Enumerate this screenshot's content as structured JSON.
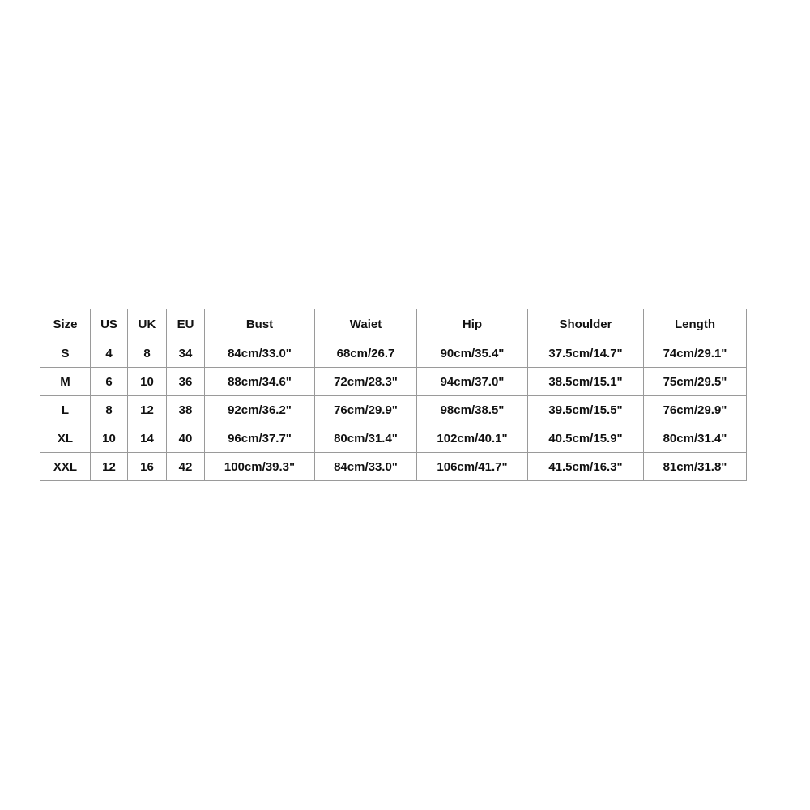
{
  "size_chart": {
    "headers": [
      "Size",
      "US",
      "UK",
      "EU",
      "Bust",
      "Waiet",
      "Hip",
      "Shoulder",
      "Length"
    ],
    "rows": [
      [
        "S",
        "4",
        "8",
        "34",
        "84cm/33.0\"",
        "68cm/26.7",
        "90cm/35.4\"",
        "37.5cm/14.7\"",
        "74cm/29.1\""
      ],
      [
        "M",
        "6",
        "10",
        "36",
        "88cm/34.6\"",
        "72cm/28.3\"",
        "94cm/37.0\"",
        "38.5cm/15.1\"",
        "75cm/29.5\""
      ],
      [
        "L",
        "8",
        "12",
        "38",
        "92cm/36.2\"",
        "76cm/29.9\"",
        "98cm/38.5\"",
        "39.5cm/15.5\"",
        "76cm/29.9\""
      ],
      [
        "XL",
        "10",
        "14",
        "40",
        "96cm/37.7\"",
        "80cm/31.4\"",
        "102cm/40.1\"",
        "40.5cm/15.9\"",
        "80cm/31.4\""
      ],
      [
        "XXL",
        "12",
        "16",
        "42",
        "100cm/39.3\"",
        "84cm/33.0\"",
        "106cm/41.7\"",
        "41.5cm/16.3\"",
        "81cm/31.8\""
      ]
    ]
  }
}
